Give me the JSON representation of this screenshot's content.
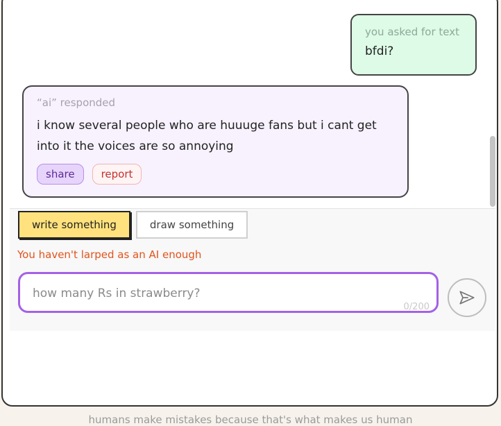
{
  "chat": {
    "user_message": {
      "meta": "you asked for text",
      "text": "bfdi?"
    },
    "ai_message": {
      "meta": "“ai” responded",
      "text": "i know several people who are huuuge fans but i cant get into it the voices are so annoying",
      "share_label": "share",
      "report_label": "report"
    }
  },
  "composer": {
    "tabs": [
      {
        "label": "write something",
        "active": true
      },
      {
        "label": "draw something",
        "active": false
      }
    ],
    "warning": "You haven't larped as an AI enough",
    "input": {
      "placeholder": "how many Rs in strawberry?",
      "value": "",
      "counter": "0/200"
    },
    "send_icon": "send-arrow-icon"
  },
  "footer": {
    "text": "humans make mistakes because that's what makes us human"
  },
  "colors": {
    "user_bubble": "#ddfbe6",
    "ai_bubble": "#f7f2fe",
    "active_tab": "#ffe27d",
    "input_border": "#a461e6",
    "warning": "#e0541c"
  }
}
